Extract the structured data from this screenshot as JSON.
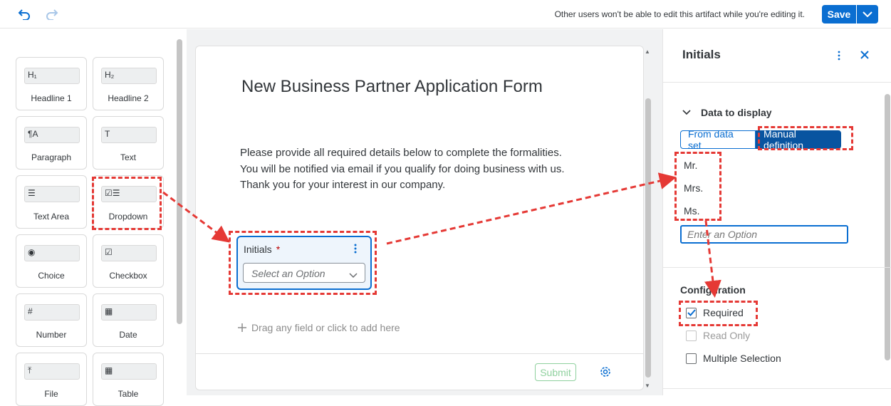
{
  "header": {
    "lock_message": "Other users won't be able to edit this artifact while you're editing it.",
    "save_label": "Save"
  },
  "palette": {
    "items": [
      {
        "label": "Headline 1",
        "icon_text": "H₁",
        "icon": "headline1-icon"
      },
      {
        "label": "Headline 2",
        "icon_text": "H₂",
        "icon": "headline2-icon"
      },
      {
        "label": "Paragraph",
        "icon_text": "¶A",
        "icon": "paragraph-icon"
      },
      {
        "label": "Text",
        "icon_text": "T",
        "icon": "text-icon"
      },
      {
        "label": "Text Area",
        "icon_text": "☰",
        "icon": "text-area-icon"
      },
      {
        "label": "Dropdown",
        "icon_text": "☑☰",
        "icon": "dropdown-icon"
      },
      {
        "label": "Choice",
        "icon_text": "◉",
        "icon": "radio-icon"
      },
      {
        "label": "Checkbox",
        "icon_text": "☑",
        "icon": "checkbox-icon"
      },
      {
        "label": "Number",
        "icon_text": "#",
        "icon": "number-icon"
      },
      {
        "label": "Date",
        "icon_text": "▦",
        "icon": "calendar-icon"
      },
      {
        "label": "File",
        "icon_text": "⤒",
        "icon": "upload-icon"
      },
      {
        "label": "Table",
        "icon_text": "▦",
        "icon": "table-icon"
      }
    ]
  },
  "form": {
    "title": "New Business Partner Application Form",
    "description": "Please provide all required details below to complete the formalities. You will be notified via email if you qualify for doing business with us. Thank you for your interest in our company.",
    "field": {
      "label": "Initials",
      "required_mark": "*",
      "placeholder": "Select an Option"
    },
    "drag_hint": "Drag any field or click to add here",
    "submit_label": "Submit"
  },
  "panel": {
    "title": "Initials",
    "data_section": "Data to display",
    "tabs": [
      "From data set",
      "Manual definition"
    ],
    "active_tab": "Manual definition",
    "options": [
      "Mr.",
      "Mrs.",
      "Ms."
    ],
    "option_placeholder": "Enter an Option",
    "config_section": "Configuration",
    "checkboxes": [
      {
        "label": "Required",
        "checked": true,
        "disabled": false
      },
      {
        "label": "Read Only",
        "checked": false,
        "disabled": true
      },
      {
        "label": "Multiple Selection",
        "checked": false,
        "disabled": false
      }
    ]
  },
  "colors": {
    "accent": "#0a6ed1",
    "active_tab": "#0854a0",
    "annotation": "#e53935",
    "required": "#bb0000"
  }
}
